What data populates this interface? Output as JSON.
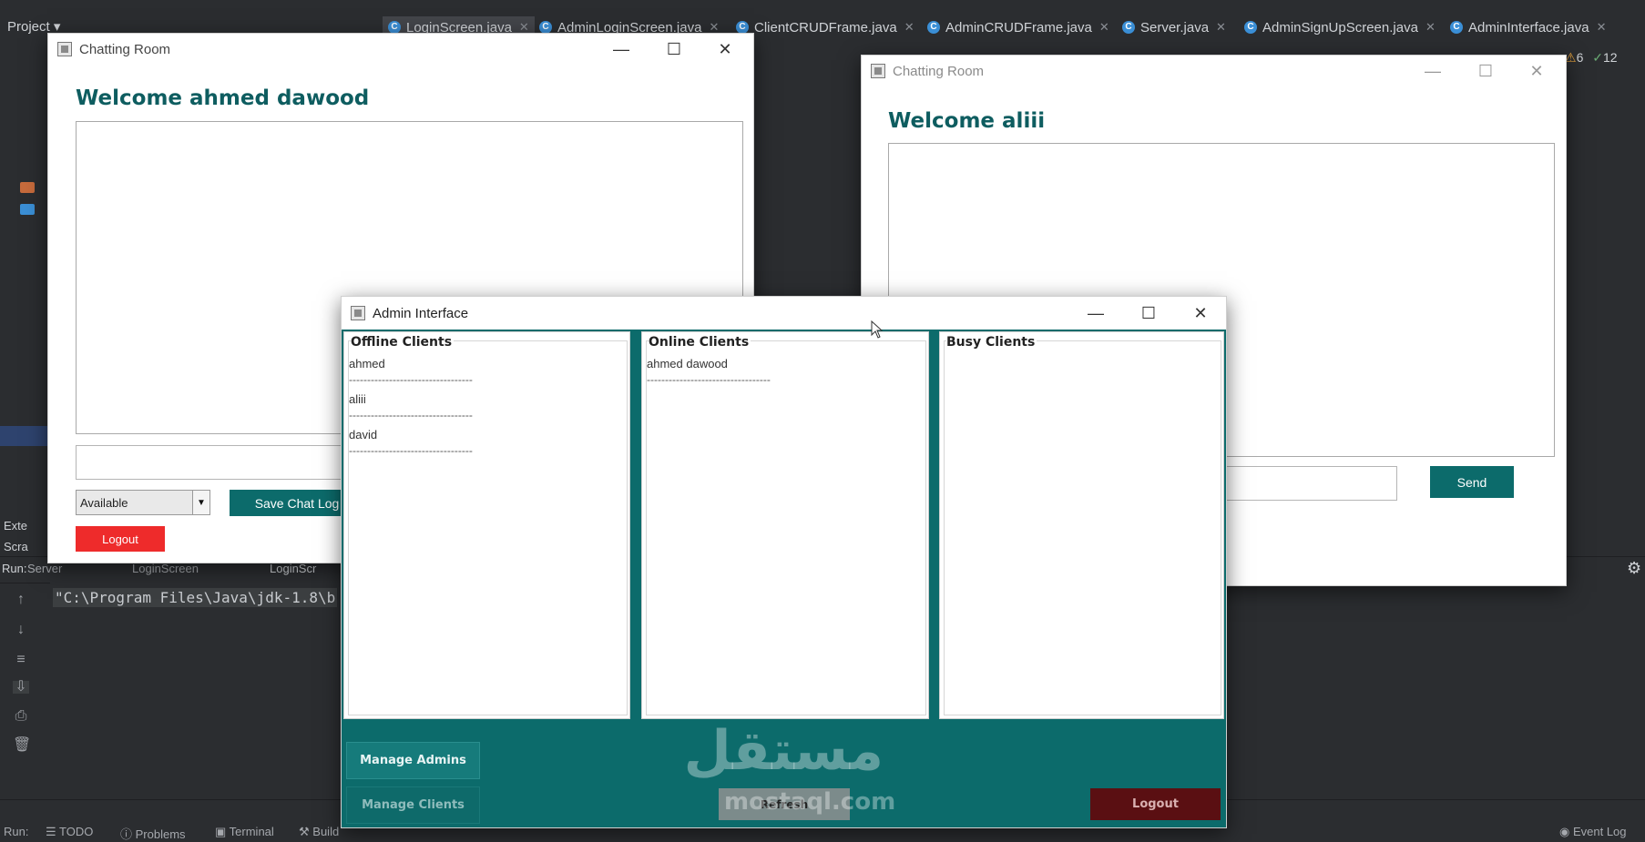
{
  "ide": {
    "project_label": "Project",
    "tabs": [
      {
        "label": "LoginScreen.java"
      },
      {
        "label": "AdminLoginScreen.java"
      },
      {
        "label": "ClientCRUDFrame.java"
      },
      {
        "label": "AdminCRUDFrame.java"
      },
      {
        "label": "Server.java"
      },
      {
        "label": "AdminSignUpScreen.java"
      },
      {
        "label": "AdminInterface.java"
      }
    ],
    "warnings_count": "6",
    "checks_count": "12",
    "run_label": "Run:",
    "run_tabs": [
      "Server",
      "LoginScreen",
      "LoginScr"
    ],
    "console_line": "\"C:\\Program Files\\Java\\jdk-1.8\\b",
    "bottom_tabs": [
      "TODO",
      "Problems",
      "Terminal",
      "Build"
    ],
    "event_log": "Event Log",
    "left_side_labels": [
      "Exte",
      "Scra"
    ]
  },
  "chat_left": {
    "title": "Chatting Room",
    "welcome": "Welcome ahmed dawood",
    "status_selected": "Available",
    "save_label": "Save Chat Log",
    "logout_label": "Logout"
  },
  "chat_right": {
    "title": "Chatting Room",
    "welcome": "Welcome aliii",
    "send_label": "Send"
  },
  "admin": {
    "title": "Admin Interface",
    "panels": [
      {
        "title": "Offline Clients",
        "items": [
          "ahmed",
          "aliii",
          "david"
        ]
      },
      {
        "title": "Online Clients",
        "items": [
          "ahmed dawood"
        ]
      },
      {
        "title": "Busy Clients",
        "items": []
      }
    ],
    "separator": "----------------------------------",
    "manage_admins": "Manage Admins",
    "manage_clients": "Manage Clients",
    "refresh": "Refresh",
    "logout": "Logout"
  },
  "watermark": {
    "arabic": "مستقل",
    "latin": "mostaql.com"
  },
  "colors": {
    "teal": "#0c6b6b",
    "logout_red": "#ee2b2b",
    "dark_red": "#5a0f12"
  }
}
